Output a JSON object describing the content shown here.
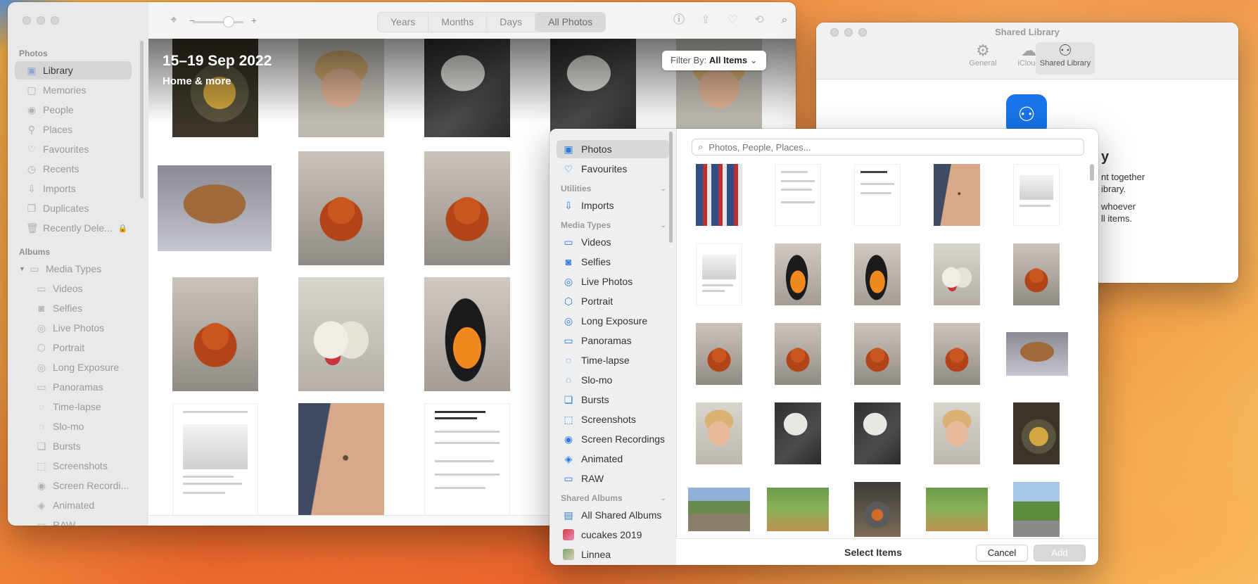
{
  "main": {
    "sidebar": {
      "section_photos": "Photos",
      "section_albums": "Albums",
      "items": [
        {
          "label": "Library",
          "icon": "library-icon"
        },
        {
          "label": "Memories",
          "icon": "memories-icon"
        },
        {
          "label": "People",
          "icon": "people-icon"
        },
        {
          "label": "Places",
          "icon": "places-icon"
        },
        {
          "label": "Favourites",
          "icon": "heart-icon"
        },
        {
          "label": "Recents",
          "icon": "clock-icon"
        },
        {
          "label": "Imports",
          "icon": "imports-icon"
        },
        {
          "label": "Duplicates",
          "icon": "duplicates-icon"
        },
        {
          "label": "Recently Dele...",
          "icon": "trash-icon"
        }
      ],
      "media_types_label": "Media Types",
      "media_types": [
        "Videos",
        "Selfies",
        "Live Photos",
        "Portrait",
        "Long Exposure",
        "Panoramas",
        "Time-lapse",
        "Slo-mo",
        "Bursts",
        "Screenshots",
        "Screen Recordi...",
        "Animated",
        "RAW"
      ]
    },
    "toolbar": {
      "zoom_minus": "−",
      "zoom_plus": "+",
      "segments": [
        "Years",
        "Months",
        "Days",
        "All Photos"
      ]
    },
    "content": {
      "date_title": "15–19 Sep 2022",
      "date_subtitle": "Home & more",
      "filter_prefix": "Filter By:",
      "filter_value": "All Items"
    }
  },
  "settings": {
    "title": "Shared Library",
    "tabs": [
      "General",
      "iCloud",
      "Shared Library"
    ],
    "heading_tail": "y",
    "line1": "nt together",
    "line2": "ibrary.",
    "line3": "whoever",
    "line4": "ll items."
  },
  "picker": {
    "items_top": [
      {
        "label": "Photos"
      },
      {
        "label": "Favourites"
      }
    ],
    "utilities_head": "Utilities",
    "imports": "Imports",
    "media_types_head": "Media Types",
    "media_types": [
      "Videos",
      "Selfies",
      "Live Photos",
      "Portrait",
      "Long Exposure",
      "Panoramas",
      "Time-lapse",
      "Slo-mo",
      "Bursts",
      "Screenshots",
      "Screen Recordings",
      "Animated",
      "RAW"
    ],
    "shared_albums_head": "Shared Albums",
    "shared_albums": [
      "All Shared Albums",
      "cucakes 2019",
      "Linnea"
    ],
    "search_placeholder": "Photos, People, Places...",
    "footer_title": "Select Items",
    "cancel": "Cancel",
    "add": "Add"
  }
}
